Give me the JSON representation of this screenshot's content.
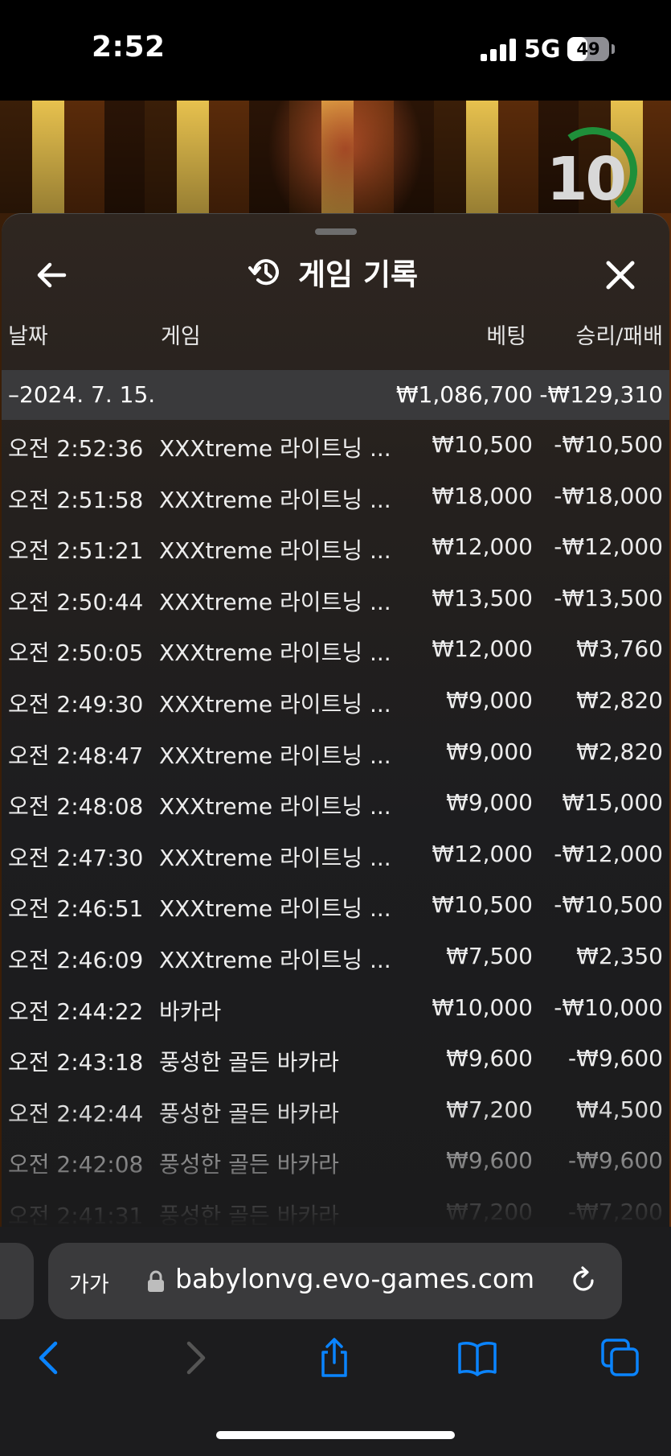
{
  "status_bar": {
    "time": "2:52",
    "network": "5G",
    "battery": "49",
    "battery_level": 0.49
  },
  "round_timer": "10",
  "header": {
    "title": "게임 기록"
  },
  "columns": {
    "date": "날짜",
    "game": "게임",
    "bet": "베팅",
    "result": "승리/패배"
  },
  "summary": {
    "date": "–2024. 7. 15.",
    "total_bet": "₩1,086,700",
    "total_result": "-₩129,310"
  },
  "rows": [
    {
      "time": "오전 2:52:36",
      "game": "XXXtreme 라이트닝 ...",
      "bet": "₩10,500",
      "result": "-₩10,500"
    },
    {
      "time": "오전 2:51:58",
      "game": "XXXtreme 라이트닝 ...",
      "bet": "₩18,000",
      "result": "-₩18,000"
    },
    {
      "time": "오전 2:51:21",
      "game": "XXXtreme 라이트닝 ...",
      "bet": "₩12,000",
      "result": "-₩12,000"
    },
    {
      "time": "오전 2:50:44",
      "game": "XXXtreme 라이트닝 ...",
      "bet": "₩13,500",
      "result": "-₩13,500"
    },
    {
      "time": "오전 2:50:05",
      "game": "XXXtreme 라이트닝 ...",
      "bet": "₩12,000",
      "result": "₩3,760"
    },
    {
      "time": "오전 2:49:30",
      "game": "XXXtreme 라이트닝 ...",
      "bet": "₩9,000",
      "result": "₩2,820"
    },
    {
      "time": "오전 2:48:47",
      "game": "XXXtreme 라이트닝 ...",
      "bet": "₩9,000",
      "result": "₩2,820"
    },
    {
      "time": "오전 2:48:08",
      "game": "XXXtreme 라이트닝 ...",
      "bet": "₩9,000",
      "result": "₩15,000"
    },
    {
      "time": "오전 2:47:30",
      "game": "XXXtreme 라이트닝 ...",
      "bet": "₩12,000",
      "result": "-₩12,000"
    },
    {
      "time": "오전 2:46:51",
      "game": "XXXtreme 라이트닝 ...",
      "bet": "₩10,500",
      "result": "-₩10,500"
    },
    {
      "time": "오전 2:46:09",
      "game": "XXXtreme 라이트닝 ...",
      "bet": "₩7,500",
      "result": "₩2,350"
    },
    {
      "time": "오전 2:44:22",
      "game": "바카라",
      "bet": "₩10,000",
      "result": "-₩10,000"
    },
    {
      "time": "오전 2:43:18",
      "game": "풍성한 골든 바카라",
      "bet": "₩9,600",
      "result": "-₩9,600"
    },
    {
      "time": "오전 2:42:44",
      "game": "풍성한 골든 바카라",
      "bet": "₩7,200",
      "result": "₩4,500"
    },
    {
      "time": "오전 2:42:08",
      "game": "풍성한 골든 바카라",
      "bet": "₩9,600",
      "result": "-₩9,600"
    },
    {
      "time": "오전 2:41:31",
      "game": "풍성한 골든 바카라",
      "bet": "₩7,200",
      "result": "-₩7,200"
    }
  ],
  "browser": {
    "aa_label": "가가",
    "url": "babylonvg.evo-games.com"
  },
  "icons": {
    "back": "arrow-left-icon",
    "close": "close-icon",
    "history": "history-icon",
    "lock": "lock-icon",
    "reload": "reload-icon",
    "nav_back": "chevron-left-icon",
    "nav_forward": "chevron-right-icon",
    "share": "share-icon",
    "bookmarks": "book-icon",
    "tabs": "tabs-icon"
  },
  "colors": {
    "accent": "#0a84ff",
    "timer": "#1f8f3a"
  }
}
